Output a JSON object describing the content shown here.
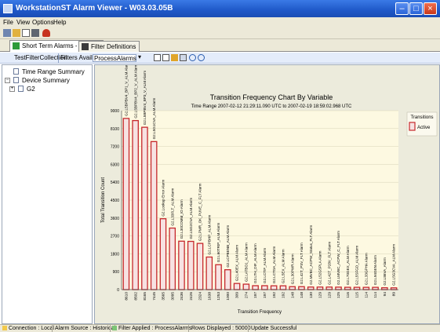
{
  "window": {
    "title": "WorkstationST Alarm Viewer - W03.03.05B"
  },
  "menu": [
    "File",
    "View",
    "Options",
    "Help"
  ],
  "tabs": [
    {
      "label": "Short Term Alarms - Filtered"
    },
    {
      "label": "Filter Definitions"
    }
  ],
  "filterbar": {
    "test_filter": "TestFilterCollection",
    "filters_available": "Filters Available",
    "selected_filter": "ProcessAlarms"
  },
  "tree": {
    "items": [
      "Time Range Summary",
      "Device Summary",
      "G2"
    ]
  },
  "status": {
    "connection": "Connection : Local",
    "alarm_source": "Alarm Source : Historical",
    "filter_applied": "Filter Applied : ProcessAlarms",
    "rows_displayed": "Rows Displayed : 50000",
    "update": "Update Successful"
  },
  "colors": {
    "bar_fill": "#f7e2e2",
    "bar_stroke": "#c6282c",
    "plot_bg": "#fdf9e1",
    "pane_bg": "#ecebdc",
    "titlebar": "#1f58c8"
  },
  "chart_data": {
    "type": "bar",
    "title": "Transition Frequency Chart By Variable",
    "subtitle": "Time Range 2007-02-12 21:29:11.090 UTC to 2007-02-19 18:59:02.968 UTC",
    "xlabel": "Transition Frequency",
    "ylabel": "Total Transition Count",
    "ylim": [
      0,
      9000
    ],
    "yticks": [
      0,
      900,
      1800,
      2700,
      3600,
      4500,
      5400,
      6300,
      7200,
      8100,
      9000
    ],
    "grid": true,
    "legend": {
      "title": "Transitions",
      "entries": [
        "Active"
      ],
      "position": "right"
    },
    "categories": [
      "G2.L5BPBV4_BP1_V_ALM Alarm",
      "G2.L5BPBV4_BP2_V_ALM Alarm",
      "G2.L5BPBV4_BP3_V_ALM Alarm",
      "G2.L5G1CVA_ALM Alarm",
      "G2.Lookup Error Alarm",
      "G2.L33FLT_ALM Alarm",
      "G2.L30COMM_IO Alarm",
      "G2.L5G2CVA_ALM Alarm",
      "G2.LPMR_OK_PUVE_C_FLT Alarm",
      "G2.LCPBHP_ALM Alarm",
      "G2.L60TRIP_ALM Alarm",
      "G2.LCPBENB_ALM Alarm",
      "G2.L40EX_ALM Alarm",
      "G2.LATBO1_ALM Alarm",
      "G2.LTH_DIF_ALM Alarm",
      "G2.LCTIF_ALM Alarm",
      "G2.LCTDA_ALM Alarm",
      "G2.L5EX_ALM Alarm",
      "G2.L30PWR Alarm",
      "G2.L42T_PSV_FLT Alarm",
      "G2.MVBC_ACPW_Status_FLT Alarm",
      "G2.L52GSPLA Alarm",
      "G2.L42T_P28V_FLT Alarm",
      "G2.LMVBC_ACPW_C_FLT Alarm",
      "G2.L70GEX_ALM Alarm",
      "G2.L5SFGD_ALM Alarm",
      "G2.L33GPHA Alarm",
      "G2.L94GEN Alarm",
      "G2.L86VA_Alarm",
      "G2.L5G3CVA_ALM Alarm"
    ],
    "values": [
      8610,
      8502,
      8165,
      7445,
      3565,
      3095,
      2436,
      2426,
      2324,
      1638,
      1253,
      1000,
      309,
      274,
      197,
      197,
      192,
      192,
      148,
      148,
      130,
      129,
      129,
      125,
      116,
      115,
      114,
      114,
      94,
      89
    ],
    "series": [
      {
        "name": "Active",
        "values": [
          8610,
          8502,
          8165,
          7445,
          3565,
          3095,
          2436,
          2426,
          2324,
          1638,
          1253,
          1000,
          309,
          274,
          197,
          197,
          192,
          192,
          148,
          148,
          130,
          129,
          129,
          125,
          116,
          115,
          114,
          114,
          94,
          89
        ]
      }
    ]
  }
}
